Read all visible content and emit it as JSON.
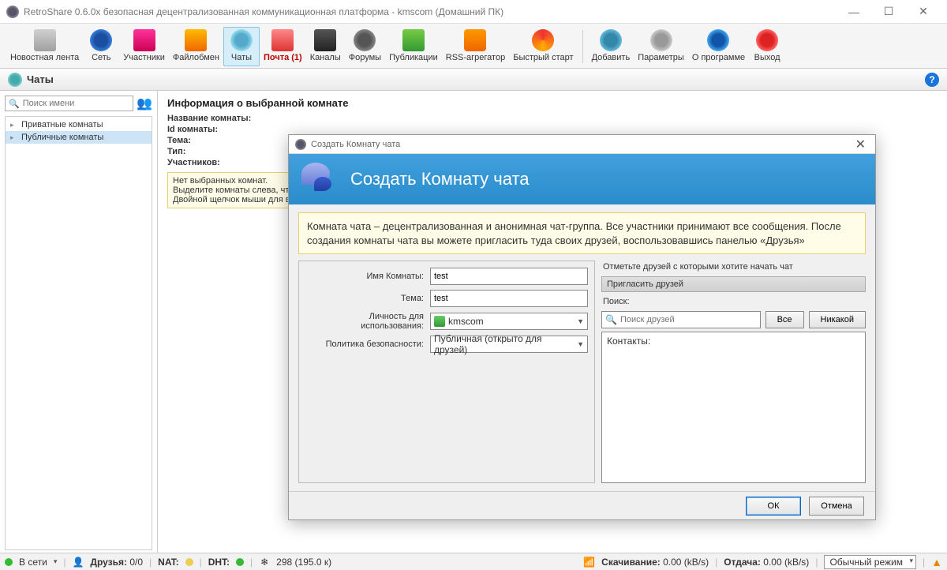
{
  "window": {
    "title": "RetroShare 0.6.0x безопасная децентрализованная коммуникационная платформа - kmscom (Домашний ПК)"
  },
  "toolbar": {
    "items": [
      {
        "label": "Новостная лента",
        "icon": "news"
      },
      {
        "label": "Сеть",
        "icon": "net"
      },
      {
        "label": "Участники",
        "icon": "users"
      },
      {
        "label": "Файлобмен",
        "icon": "file"
      },
      {
        "label": "Чаты",
        "icon": "chat",
        "selected": true
      },
      {
        "label": "Почта (1)",
        "icon": "mail",
        "red": true
      },
      {
        "label": "Каналы",
        "icon": "chan"
      },
      {
        "label": "Форумы",
        "icon": "forum"
      },
      {
        "label": "Публикации",
        "icon": "pub"
      },
      {
        "label": "RSS-агрегатор",
        "icon": "rss"
      },
      {
        "label": "Быстрый старт",
        "icon": "quick"
      }
    ],
    "right_items": [
      {
        "label": "Добавить",
        "icon": "add"
      },
      {
        "label": "Параметры",
        "icon": "opt"
      },
      {
        "label": "О программе",
        "icon": "about"
      },
      {
        "label": "Выход",
        "icon": "exit"
      }
    ]
  },
  "subheader": {
    "title": "Чаты"
  },
  "left": {
    "search_placeholder": "Поиск имени",
    "tree": [
      "Приватные комнаты",
      "Публичные комнаты"
    ],
    "selected_index": 1
  },
  "info": {
    "heading": "Информация о выбранной комнате",
    "rows": [
      "Название комнаты:",
      "Id комнаты:",
      "Тема:",
      "Тип:",
      "Участников:"
    ],
    "hint": "Нет выбранных комнат.\nВыделите комнаты слева, чтобы посмотреть информацию о них.\nДвойной щелчок мыши для входа и участия в чате."
  },
  "dialog": {
    "title": "Создать Комнату чата",
    "banner": "Создать Комнату чата",
    "note": "Комната чата – децентрализованная и анонимная чат-группа. Все участники принимают все сообщения. После создания комнаты чата вы можете пригласить туда своих друзей, воспользовавшись панелью «Друзья»",
    "fields": {
      "name_label": "Имя Комнаты:",
      "name_value": "test",
      "topic_label": "Тема:",
      "topic_value": "test",
      "identity_label": "Личность для использования:",
      "identity_value": "kmscom",
      "policy_label": "Политика безопасности:",
      "policy_value": "Публичная (открыто для друзей)"
    },
    "right": {
      "mark_friends": "Отметьте друзей с которыми хотите начать чат",
      "invite_header": "Пригласить друзей",
      "search_label": "Поиск:",
      "search_placeholder": "Поиск друзей",
      "btn_all": "Все",
      "btn_none": "Никакой",
      "contacts_label": "Контакты:"
    },
    "buttons": {
      "ok": "ОК",
      "cancel": "Отмена"
    }
  },
  "status": {
    "online": "В сети",
    "friends_label": "Друзья:",
    "friends_value": "0/0",
    "nat": "NAT:",
    "dht": "DHT:",
    "peers": "298  (195.0 к)",
    "download_label": "Скачивание:",
    "download_value": "0.00 (kB/s)",
    "upload_label": "Отдача:",
    "upload_value": "0.00 (kB/s)",
    "mode": "Обычный режим"
  }
}
